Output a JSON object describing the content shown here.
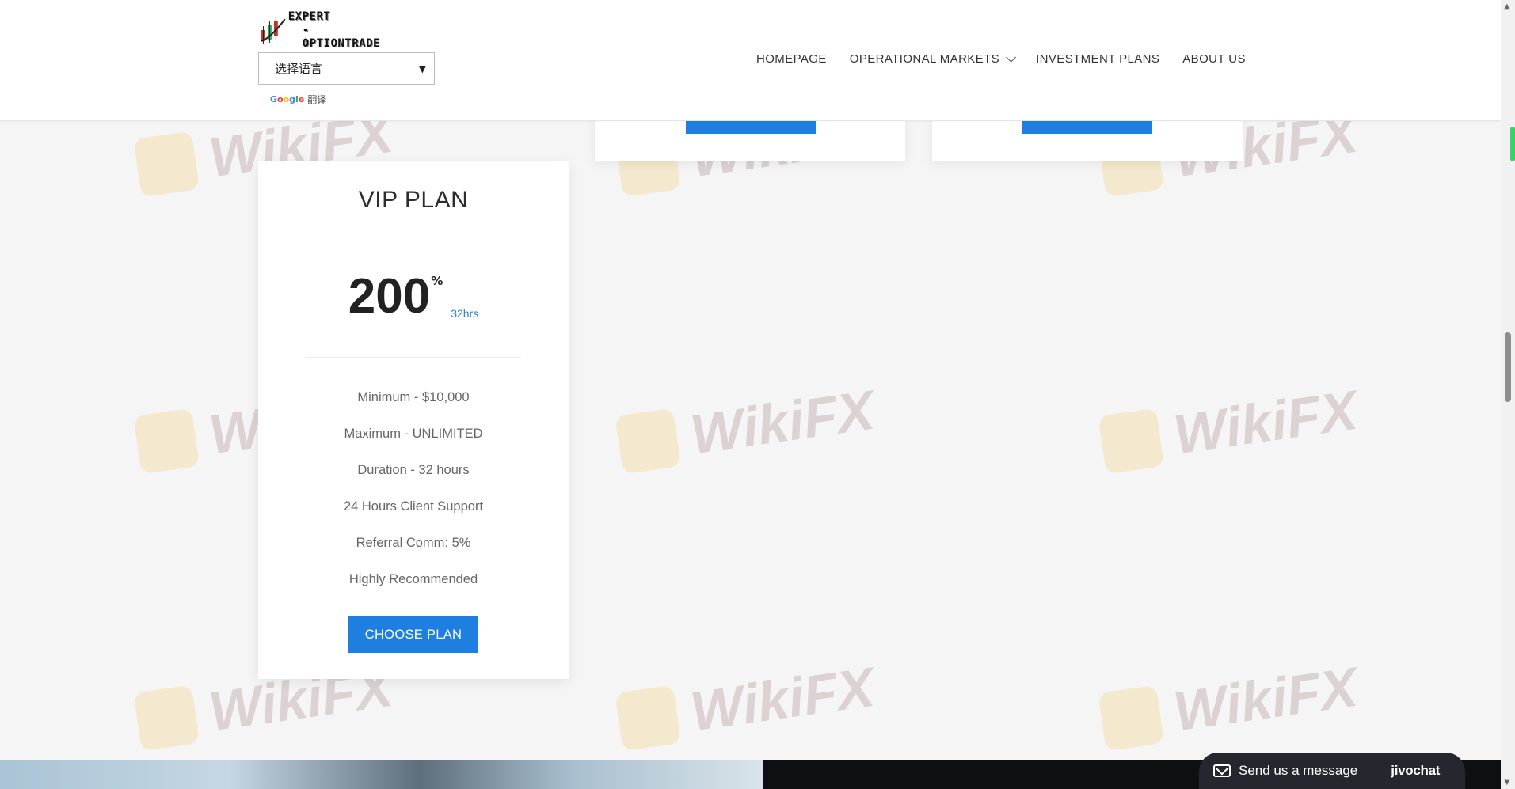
{
  "header": {
    "logo": {
      "line1": "EXPERT",
      "line2": "-OPTIONTRADE"
    },
    "language_select": {
      "value": "选择语言"
    },
    "google_credit": {
      "label": "翻译"
    }
  },
  "nav": {
    "items": [
      {
        "label": "HOMEPAGE"
      },
      {
        "label": "OPERATIONAL MARKETS",
        "has_dropdown": true
      },
      {
        "label": "INVESTMENT PLANS"
      },
      {
        "label": "ABOUT US"
      }
    ]
  },
  "watermark": {
    "text": "WikiFX"
  },
  "plan": {
    "title": "VIP PLAN",
    "rate": "200",
    "rate_unit": "%",
    "duration": "32hrs",
    "features": [
      "Minimum - $10,000",
      "Maximum - UNLIMITED",
      "Duration - 32 hours",
      "24 Hours Client Support",
      "Referral Comm: 5%",
      "Highly Recommended"
    ],
    "button_label": "CHOOSE PLAN"
  },
  "chat": {
    "label": "Send us a message",
    "brand": "jivochat"
  },
  "colors": {
    "accent": "#1f7fe0",
    "duration_text": "#2b7fd1",
    "chat_bg": "#26272e"
  }
}
